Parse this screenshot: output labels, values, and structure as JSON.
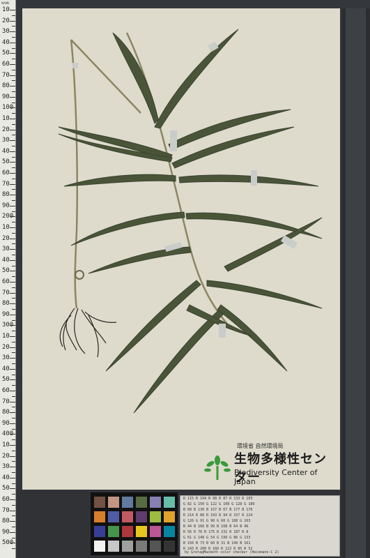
{
  "ruler": {
    "labels": [
      "10",
      "20",
      "30",
      "40",
      "50",
      "60",
      "70",
      "80",
      "90",
      "100",
      "10",
      "20",
      "30",
      "40",
      "50",
      "60",
      "70",
      "80",
      "90",
      "200",
      "10",
      "20",
      "30",
      "40",
      "50",
      "60",
      "70",
      "80",
      "90",
      "300",
      "10",
      "20",
      "30",
      "40",
      "50",
      "60",
      "70",
      "80",
      "90",
      "400",
      "10",
      "20",
      "30",
      "40",
      "50",
      "60",
      "70",
      "80",
      "90",
      "500"
    ]
  },
  "logo": {
    "ministry": "環境省 自然環境局",
    "name_jp": "生物多様性センター",
    "name_en": "Biodiversity Center of Japan"
  },
  "grey_sheet": {
    "rows": [
      "R 115  R 194  R 98   R 87   R 133  R 103",
      "G 82   G 150  G 122  G 108  G 128  G 189",
      "B 68   B 130  B 157  B 67   B 177  B 170",
      "R 214  R 80   R 193  R 94   R 157  R 224",
      "G 126  G 91   G 90   G 60   G 188  G 163",
      "B 44   B 166  B 99   B 108  B 64   B 46",
      "R 56   R 70   R 175  R 231  R 187  R 8",
      "G 61   G 148  G 54   G 199  G 86   G 133",
      "B 150  B 73   B 60   B 31   B 149  B 161",
      "R 243  R 200  R 160  R 122  R 85   R 52"
    ],
    "footer": "by GretagMacbeth color checker (Heinmann-C 2)"
  },
  "top_note": "NAME"
}
